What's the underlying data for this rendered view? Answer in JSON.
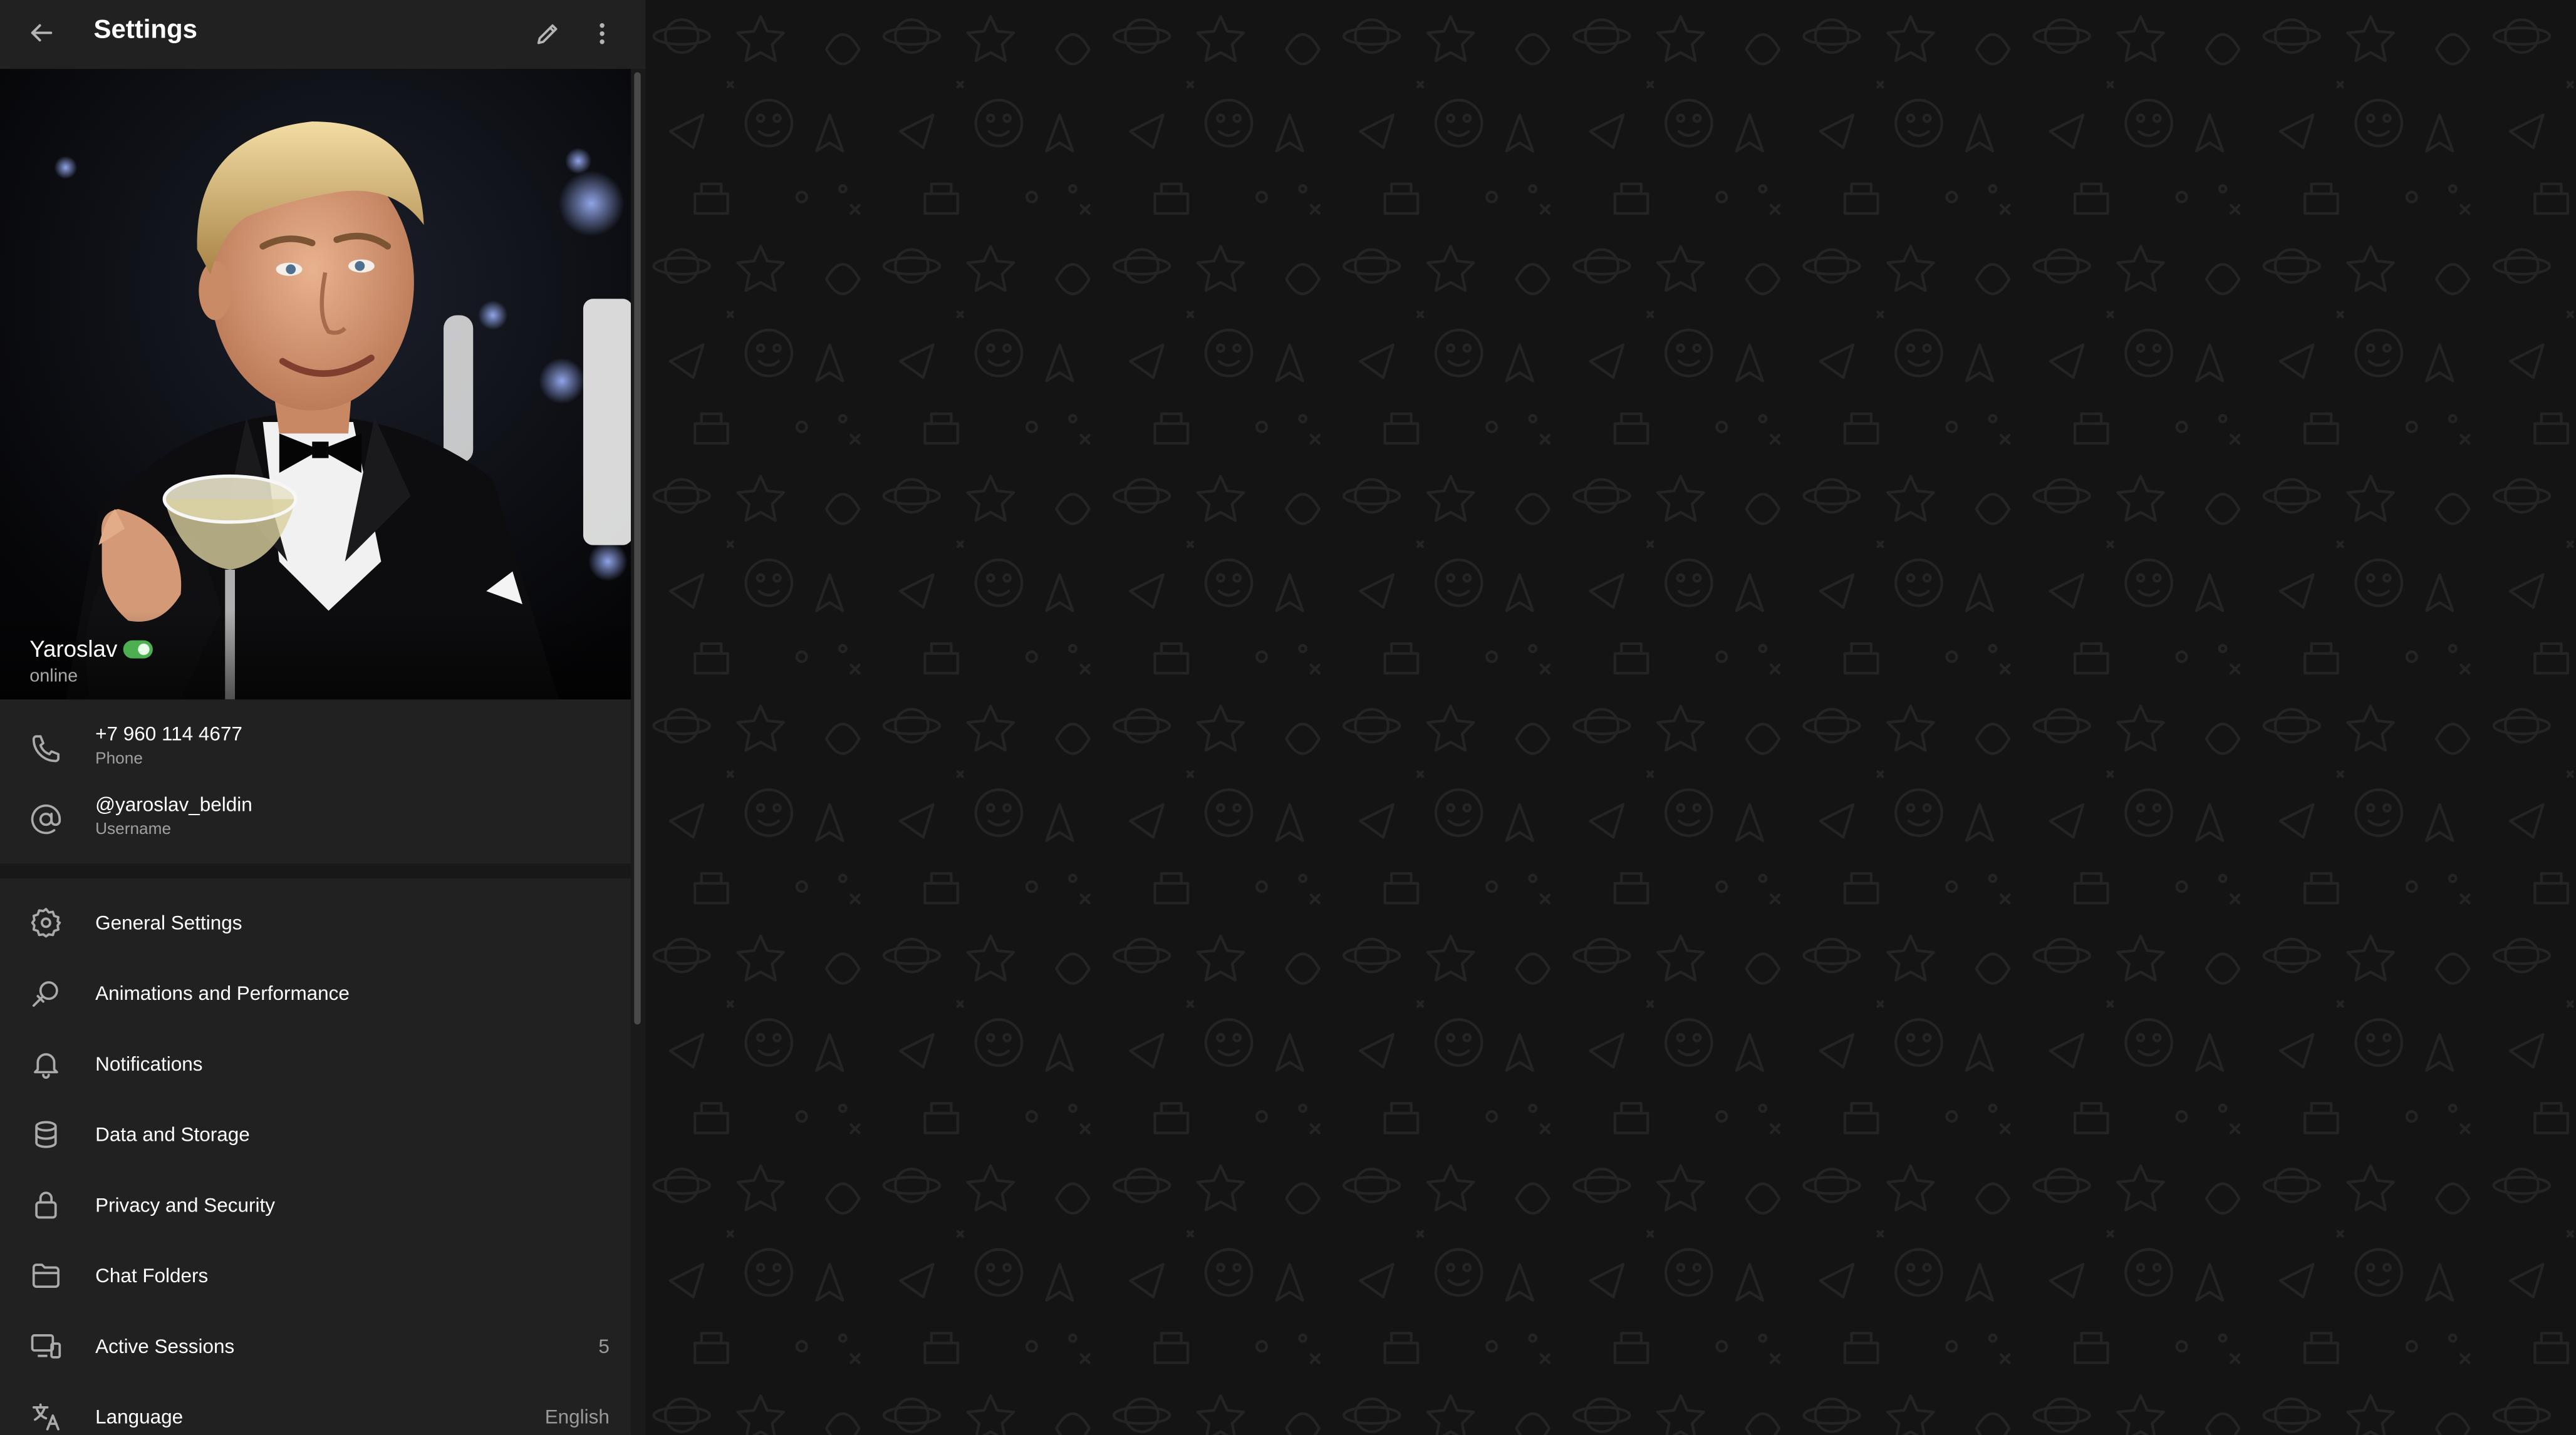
{
  "header": {
    "title": "Settings",
    "back_icon": "back-arrow-icon",
    "edit_icon": "pencil-icon",
    "more_icon": "more-vertical-icon"
  },
  "profile": {
    "name": "Yaroslav",
    "status": "online",
    "badge_color": "#4caf50"
  },
  "info": [
    {
      "icon": "phone-icon",
      "value": "+7 960 114 4677",
      "label": "Phone"
    },
    {
      "icon": "at-sign-icon",
      "value": "@yaroslav_beldin",
      "label": "Username"
    }
  ],
  "menu": [
    {
      "icon": "gear-icon",
      "label": "General Settings",
      "value": ""
    },
    {
      "icon": "animation-icon",
      "label": "Animations and Performance",
      "value": ""
    },
    {
      "icon": "bell-icon",
      "label": "Notifications",
      "value": ""
    },
    {
      "icon": "database-icon",
      "label": "Data and Storage",
      "value": ""
    },
    {
      "icon": "lock-icon",
      "label": "Privacy and Security",
      "value": ""
    },
    {
      "icon": "folder-icon",
      "label": "Chat Folders",
      "value": ""
    },
    {
      "icon": "devices-icon",
      "label": "Active Sessions",
      "value": "5"
    },
    {
      "icon": "translate-icon",
      "label": "Language",
      "value": "English"
    }
  ],
  "theme": {
    "panel": "#212121",
    "text": "#ffffff",
    "secondary_text": "#a0a0a0",
    "chat_background": "#141414"
  }
}
